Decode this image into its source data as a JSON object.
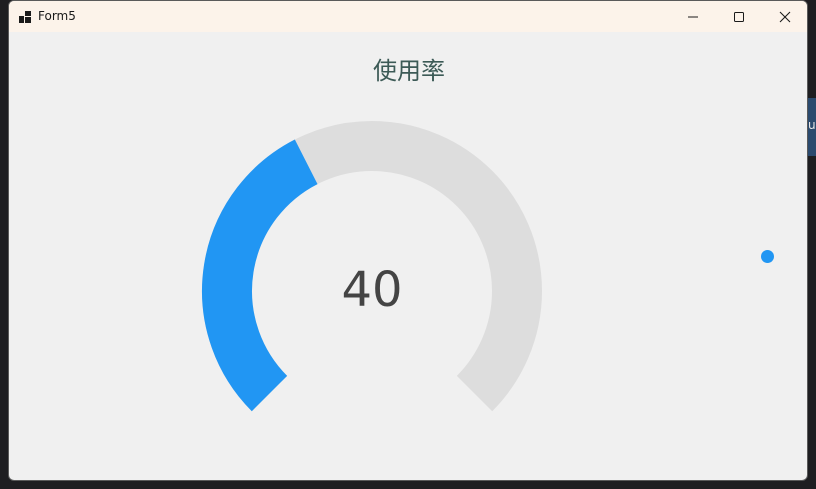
{
  "window": {
    "title": "Form5",
    "icon": "windows-app-icon"
  },
  "caption_buttons": {
    "minimize_icon": "minimize-icon",
    "maximize_icon": "maximize-icon",
    "close_icon": "close-icon"
  },
  "desktop": {
    "edge_text": "u"
  },
  "gauge": {
    "title": "使用率",
    "value": "40",
    "value_number": 40,
    "min": 0,
    "max": 100,
    "fill_color": "#2196f3",
    "track_color": "#dddddd",
    "sweep_degrees": 270
  },
  "indicator": {
    "color": "#2196f3"
  }
}
